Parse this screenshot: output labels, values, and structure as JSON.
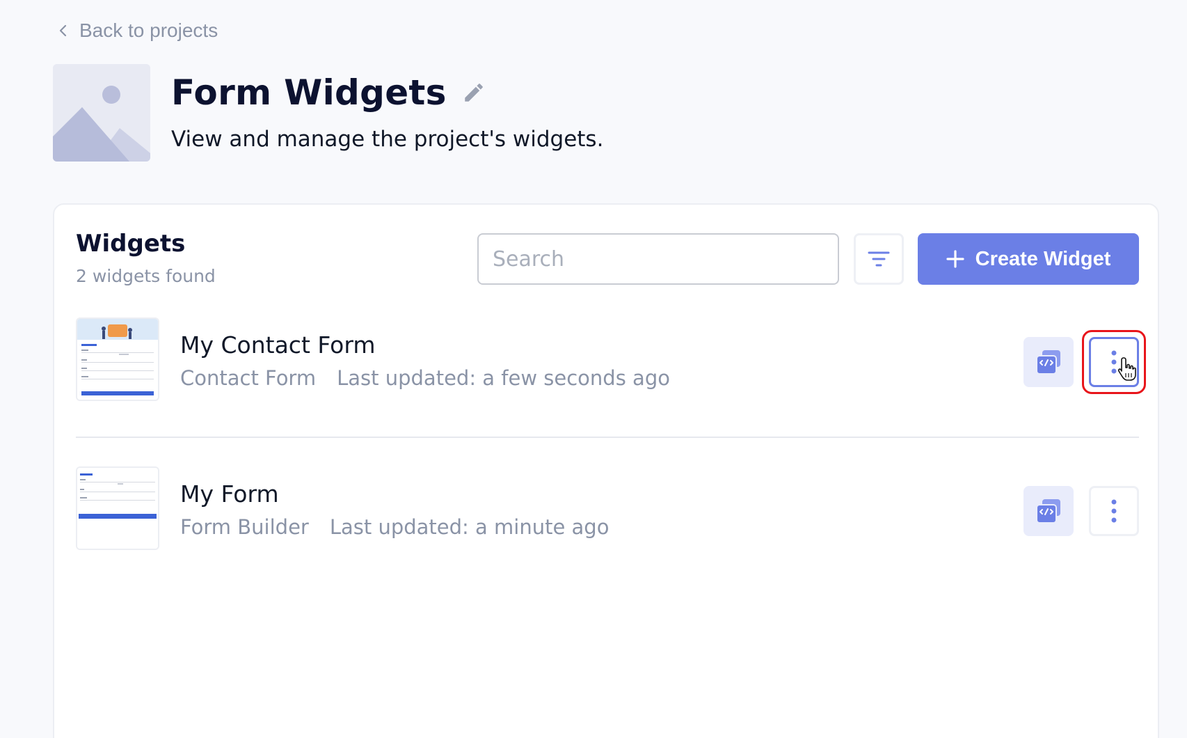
{
  "nav": {
    "back_label": "Back to projects"
  },
  "project": {
    "title": "Form Widgets",
    "subtitle": "View and manage the project's widgets."
  },
  "widgets_panel": {
    "title": "Widgets",
    "count_text": "2 widgets found",
    "search_placeholder": "Search",
    "create_label": "Create Widget"
  },
  "widgets": [
    {
      "name": "My Contact Form",
      "type": "Contact Form",
      "updated": "Last updated: a few seconds ago"
    },
    {
      "name": "My Form",
      "type": "Form Builder",
      "updated": "Last updated: a minute ago"
    }
  ],
  "colors": {
    "accent": "#6b7fe6",
    "highlight": "#e8151b",
    "muted_text": "#8a93a6"
  },
  "icons": [
    "chevron-left-icon",
    "image-placeholder-icon",
    "pencil-icon",
    "filter-icon",
    "plus-icon",
    "embed-code-icon",
    "more-vertical-icon",
    "hand-cursor-icon"
  ]
}
